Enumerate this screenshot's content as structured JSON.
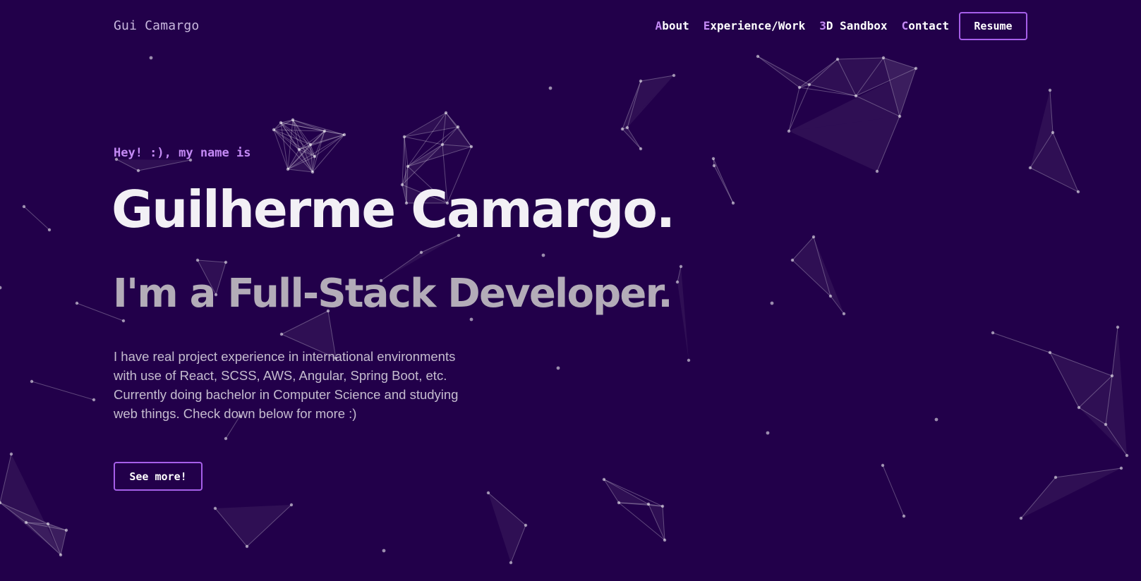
{
  "header": {
    "logo": "Gui Camargo",
    "nav": [
      {
        "first": "A",
        "rest": "bout"
      },
      {
        "first": "E",
        "rest": "xperience/Work"
      },
      {
        "first": "3",
        "rest": "D Sandbox"
      },
      {
        "first": "C",
        "rest": "ontact"
      }
    ],
    "resume_label": "Resume"
  },
  "hero": {
    "greeting": "Hey! :), my name is",
    "name": "Guilherme Camargo.",
    "role": "I'm a Full-Stack Developer.",
    "description": "I have real project experience in international environments with use of React, SCSS, AWS, Angular, Spring Boot, etc. Currently doing bachelor in Computer Science and studying web things. Check down below for more :)",
    "cta_label": "See more!"
  },
  "theme": {
    "background": "#22004a",
    "accent": "#a65fe9",
    "accent_text": "#c48af5"
  }
}
